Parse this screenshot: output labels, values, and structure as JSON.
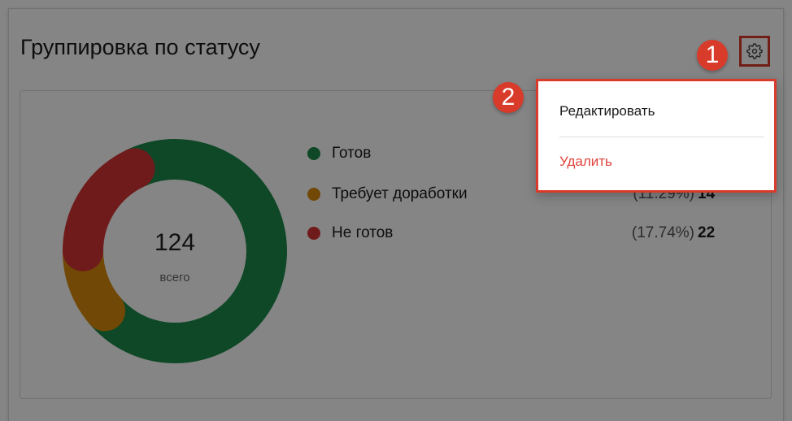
{
  "widget": {
    "title": "Группировка по статусу",
    "total_value": "124",
    "total_label": "всего",
    "settings_icon": "gear-icon"
  },
  "legend": [
    {
      "label": "Готов",
      "percent": "",
      "count": "",
      "color": "#1e8a4c"
    },
    {
      "label": "Требует доработки",
      "percent": "(11.29%)",
      "count": "14",
      "color": "#d98b0c"
    },
    {
      "label": "Не готов",
      "percent": "(17.74%)",
      "count": "22",
      "color": "#d63434"
    }
  ],
  "chart_data": {
    "type": "pie",
    "variant": "donut",
    "categories": [
      "Готов",
      "Требует доработки",
      "Не готов"
    ],
    "values": [
      88,
      14,
      22
    ],
    "percents": [
      70.97,
      11.29,
      17.74
    ],
    "colors": [
      "#1e8a4c",
      "#d98b0c",
      "#d63434"
    ],
    "total": 124
  },
  "menu": {
    "edit_label": "Редактировать",
    "delete_label": "Удалить"
  },
  "annotations": {
    "step1": "1",
    "step2": "2"
  },
  "colors": {
    "annotation_red": "#d93b2b",
    "delete_red": "#e0443c"
  }
}
